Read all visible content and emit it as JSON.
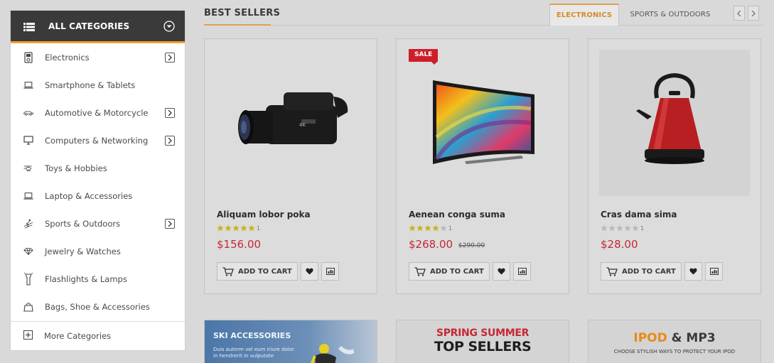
{
  "sidebar": {
    "title": "ALL CATEGORIES",
    "items": [
      {
        "label": "Electronics",
        "icon": "ipod-icon",
        "has_submenu": true
      },
      {
        "label": "Smartphone & Tablets",
        "icon": "laptop-icon",
        "has_submenu": false
      },
      {
        "label": "Automotive & Motorcycle",
        "icon": "car-icon",
        "has_submenu": true
      },
      {
        "label": "Computers & Networking",
        "icon": "monitor-icon",
        "has_submenu": true
      },
      {
        "label": "Toys & Hobbies",
        "icon": "helicopter-icon",
        "has_submenu": false
      },
      {
        "label": "Laptop & Accessories",
        "icon": "laptop-icon",
        "has_submenu": false
      },
      {
        "label": "Sports & Outdoors",
        "icon": "ski-icon",
        "has_submenu": true
      },
      {
        "label": "Jewelry & Watches",
        "icon": "diamond-icon",
        "has_submenu": false
      },
      {
        "label": "Flashlights & Lamps",
        "icon": "flashlight-icon",
        "has_submenu": false
      },
      {
        "label": "Bags, Shoe & Accessories",
        "icon": "bag-icon",
        "has_submenu": false
      }
    ],
    "more_label": "More Categories"
  },
  "section": {
    "title": "BEST SELLERS",
    "tabs": [
      {
        "label": "ELECTRONICS",
        "active": true
      },
      {
        "label": "SPORTS & OUTDOORS",
        "active": false
      }
    ]
  },
  "products": [
    {
      "name": "Aliquam lobor poka",
      "rating": 5,
      "review_count": "1",
      "price": "$156.00",
      "old_price": "",
      "sale": false,
      "image": "camcorder-image"
    },
    {
      "name": "Aenean conga suma",
      "rating": 4,
      "review_count": "1",
      "price": "$268.00",
      "old_price": "$290.00",
      "sale": true,
      "sale_label": "SALE",
      "image": "curved-tv-image"
    },
    {
      "name": "Cras dama sima",
      "rating": 0,
      "review_count": "1",
      "price": "$28.00",
      "old_price": "",
      "sale": false,
      "image": "kettle-image"
    }
  ],
  "actions": {
    "add_to_cart": "ADD TO CART"
  },
  "banners": {
    "ski": {
      "title": "SKI ACCESSORIES",
      "text": "Duis auterm vel eum iriure dolor in hendrerit in vulputate"
    },
    "spring": {
      "line1": "SPRING SUMMER",
      "line2": "TOP SELLERS"
    },
    "ipod": {
      "title_a": "IPOD",
      "title_b": " & MP3",
      "subtitle": "CHOOSE STYLISH WAYS TO PROTECT YOUR IPOD"
    }
  },
  "colors": {
    "accent": "#e0a050",
    "price": "#c62836",
    "header_bg": "#3a3a3a",
    "star_on": "#c9b21c",
    "star_off": "#b8b8b8"
  }
}
